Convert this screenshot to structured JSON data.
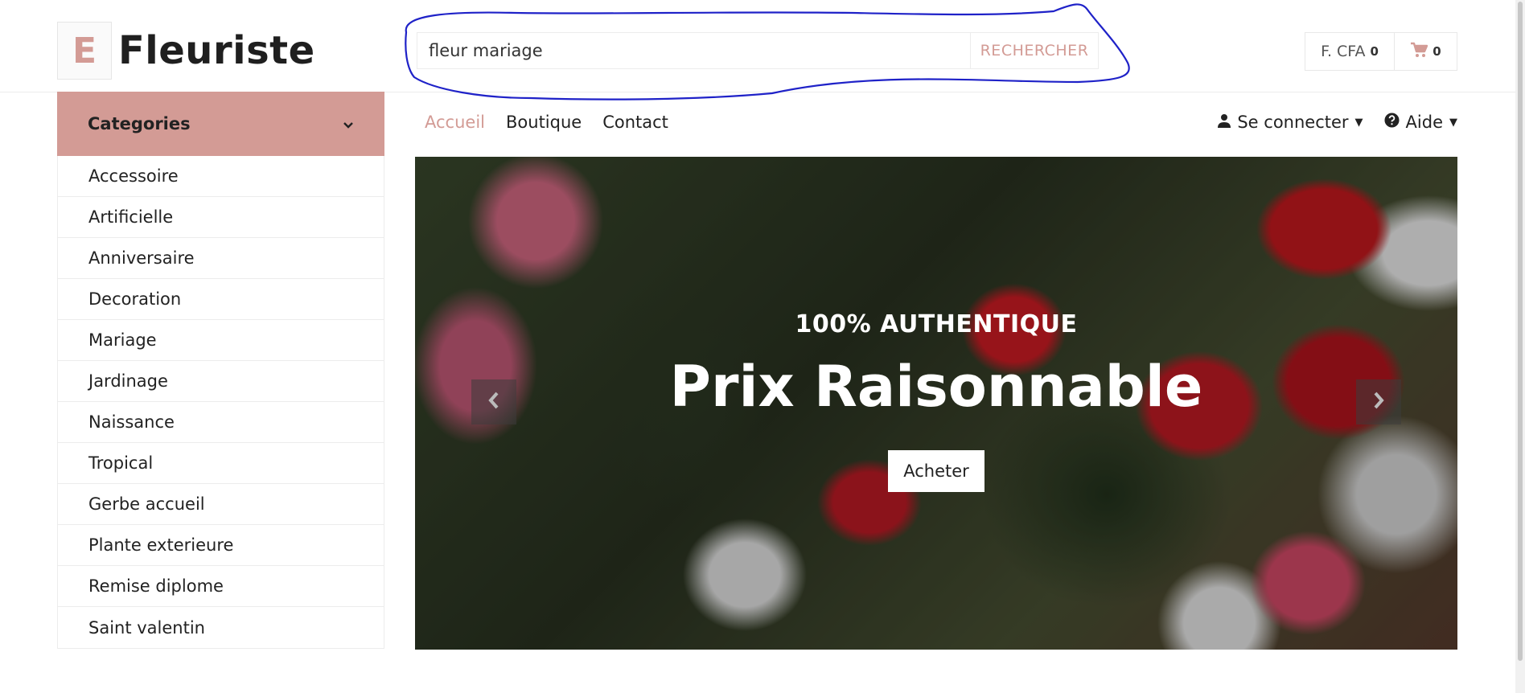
{
  "logo": {
    "letter": "E",
    "name": "Fleuriste"
  },
  "search": {
    "value": "fleur mariage",
    "placeholder": "",
    "button_label": "RECHERCHER"
  },
  "currency": {
    "label": "F. CFA",
    "count": "0"
  },
  "cart": {
    "icon": "cart-icon",
    "count": "0"
  },
  "categories": {
    "title": "Categories",
    "items": [
      "Accessoire",
      "Artificielle",
      "Anniversaire",
      "Decoration",
      "Mariage",
      "Jardinage",
      "Naissance",
      "Tropical",
      "Gerbe accueil",
      "Plante exterieure",
      "Remise diplome",
      "Saint valentin"
    ]
  },
  "nav": {
    "links": [
      {
        "label": "Accueil",
        "active": true
      },
      {
        "label": "Boutique",
        "active": false
      },
      {
        "label": "Contact",
        "active": false
      }
    ],
    "login_label": "Se connecter",
    "help_label": "Aide"
  },
  "hero": {
    "subtitle": "100% AUTHENTIQUE",
    "title": "Prix Raisonnable",
    "button_label": "Acheter"
  },
  "colors": {
    "accent": "#d39b95",
    "annotation": "#1f22c8"
  }
}
